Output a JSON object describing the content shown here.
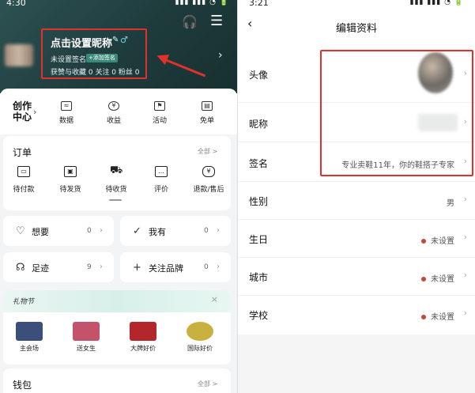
{
  "left": {
    "status_time": "4:30",
    "status_icons": "▮▮▮ ▮▮▮ ◔ 🔋",
    "profile": {
      "nickname_prompt": "点击设置昵称",
      "signature_status": "未设置签名",
      "tag": "+添加签名",
      "stats": "获赞与收藏 0   关注 0   粉丝 0"
    },
    "creator": {
      "title_line1": "创作",
      "title_line2": "中心",
      "items": [
        {
          "label": "数据",
          "icon": "chart-icon"
        },
        {
          "label": "收益",
          "icon": "coin-icon"
        },
        {
          "label": "活动",
          "icon": "flag-icon"
        },
        {
          "label": "免单",
          "icon": "bag-icon"
        }
      ]
    },
    "orders": {
      "title": "订单",
      "all": "全部 >",
      "items": [
        {
          "label": "待付款",
          "glyph": "▭"
        },
        {
          "label": "待发货",
          "glyph": "▣"
        },
        {
          "label": "待收货",
          "glyph": "⛟"
        },
        {
          "label": "评价",
          "glyph": "…"
        },
        {
          "label": "退款/售后",
          "glyph": "¥"
        }
      ]
    },
    "shortcuts": [
      {
        "icon": "♡",
        "label": "想要",
        "count": "0"
      },
      {
        "icon": "✓",
        "label": "我有",
        "count": "0"
      },
      {
        "icon": "☊",
        "label": "足迹",
        "count": "9"
      },
      {
        "icon": "+",
        "label": "关注品牌",
        "count": "0"
      }
    ],
    "promo": {
      "title": "礼物节",
      "close": "×",
      "items": [
        {
          "label": "主会场",
          "color": "#3b4f7a"
        },
        {
          "label": "送女生",
          "color": "#c4526a"
        },
        {
          "label": "大牌好价",
          "color": "#b2262c"
        },
        {
          "label": "国际好价",
          "color": "#c8b13e"
        }
      ]
    },
    "wallet": {
      "title": "钱包",
      "all": "全部 >"
    }
  },
  "right": {
    "status_time": "3:21",
    "status_icons": "▮▮▮ ▮▮▮ ◔ 🔋",
    "title": "编辑资料",
    "rows": [
      {
        "label": "头像",
        "value": ""
      },
      {
        "label": "昵称",
        "value": ""
      },
      {
        "label": "签名",
        "value": "专业卖鞋11年，你的鞋搭子专家"
      },
      {
        "label": "性别",
        "value": "男"
      },
      {
        "label": "生日",
        "value": "未设置"
      },
      {
        "label": "城市",
        "value": "未设置"
      },
      {
        "label": "学校",
        "value": "未设置"
      }
    ]
  },
  "colors": {
    "highlight_red": "#e0312d",
    "hero_teal": "#2d5152",
    "dot_red": "#c9453b"
  }
}
